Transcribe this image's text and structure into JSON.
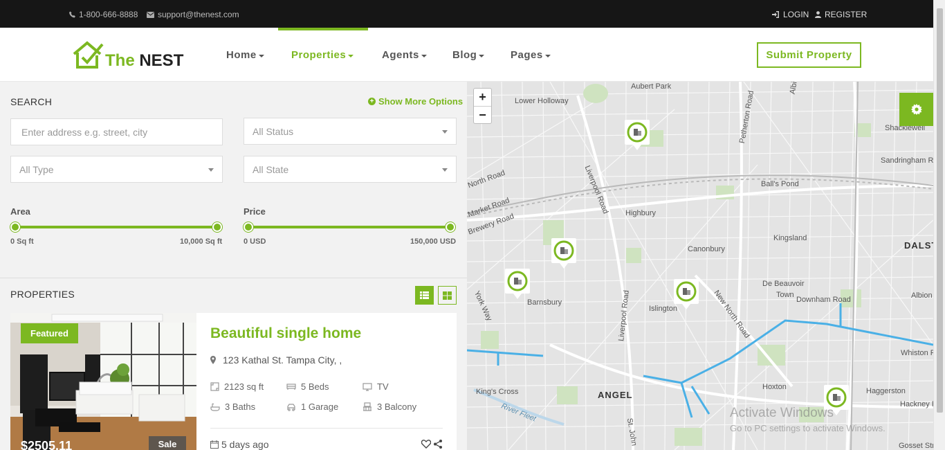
{
  "topbar": {
    "phone": "1-800-666-8888",
    "email": "support@thenest.com",
    "login": "LOGIN",
    "register": "REGISTER"
  },
  "header": {
    "logo_the": "The",
    "logo_nest": "NEST",
    "nav": [
      {
        "label": "Home"
      },
      {
        "label": "Properties"
      },
      {
        "label": "Agents"
      },
      {
        "label": "Blog"
      },
      {
        "label": "Pages"
      }
    ],
    "active_nav": "Properties",
    "submit_label": "Submit Property"
  },
  "search": {
    "title": "SEARCH",
    "more_options": "Show More Options",
    "address_placeholder": "Enter address e.g. street, city",
    "status": "All Status",
    "type": "All Type",
    "state": "All State",
    "area": {
      "label": "Area",
      "min": "0 Sq ft",
      "max": "10,000 Sq ft",
      "range": [
        0,
        10000
      ]
    },
    "price": {
      "label": "Price",
      "min": "0 USD",
      "max": "150,000 USD",
      "range": [
        0,
        150000
      ]
    }
  },
  "properties": {
    "title": "PROPERTIES",
    "view_mode": "list",
    "card": {
      "badge": "Featured",
      "price": "$2505.11",
      "tag": "Sale",
      "title": "Beautiful single home",
      "address": "123 Kathal St. Tampa City, ,",
      "features": [
        {
          "icon": "area-icon",
          "text": "2123 sq ft"
        },
        {
          "icon": "bed-icon",
          "text": "5 Beds"
        },
        {
          "icon": "tv-icon",
          "text": "TV"
        },
        {
          "icon": "bath-icon",
          "text": "3 Baths"
        },
        {
          "icon": "garage-icon",
          "text": "1 Garage"
        },
        {
          "icon": "balcony-icon",
          "text": "3 Balcony"
        }
      ],
      "date": "5 days ago"
    }
  },
  "map": {
    "zoom_in": "+",
    "zoom_out": "−",
    "labels": {
      "aubert_park": "Aubert Park",
      "lower_holloway": "Lower Holloway",
      "shacklewell": "Shacklewell",
      "sandringham": "Sandringham Ro",
      "north_road": "North Road",
      "liverpool_road": "Liverpool Road",
      "petherton": "Petherton Road",
      "albion_top": "Albi",
      "market_road": "Market Road",
      "brewery_road": "Brewery Road",
      "balls_pond": "Ball's Pond",
      "highbury": "Highbury",
      "kingsland": "Kingsland",
      "dalston": "DALST",
      "canonbury": "Canonbury",
      "york_way": "York Way",
      "barnsbury": "Barnsbury",
      "de_beauvoir": "De Beauvoir",
      "town": "Town",
      "downham": "Downham Road",
      "albion": "Albion",
      "islington": "Islington",
      "new_north": "New North Road",
      "whiston": "Whiston Roa",
      "kings_cross": "King's Cross",
      "angel": "ANGEL",
      "hoxton": "Hoxton",
      "haggerston": "Haggerston",
      "hackney": "Hackney R",
      "river_fleet": "River Fleet",
      "st_john": "St. John",
      "gosset": "Gosset Str"
    },
    "water_color": "#4ab0e6",
    "accent": "#7cb821"
  },
  "os_watermark": {
    "title": "Activate Windows",
    "subtitle": "Go to PC settings to activate Windows."
  }
}
